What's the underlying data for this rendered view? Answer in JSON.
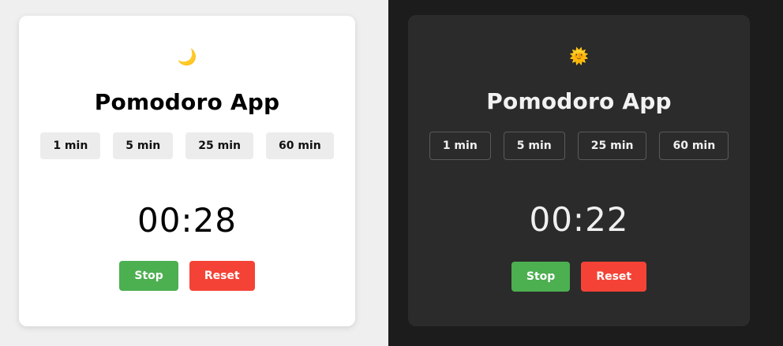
{
  "panels": [
    {
      "theme": "light",
      "theme_icon": "🌙",
      "theme_icon_name": "moon-icon",
      "title": "Pomodoro App",
      "durations": [
        "1 min",
        "5 min",
        "25 min",
        "60 min"
      ],
      "timer": "00:28",
      "stop_label": "Stop",
      "reset_label": "Reset"
    },
    {
      "theme": "dark",
      "theme_icon": "🌞",
      "theme_icon_name": "sun-icon",
      "title": "Pomodoro App",
      "durations": [
        "1 min",
        "5 min",
        "25 min",
        "60 min"
      ],
      "timer": "00:22",
      "stop_label": "Stop",
      "reset_label": "Reset"
    }
  ],
  "colors": {
    "stop": "#4caf50",
    "reset": "#f44336",
    "light_bg": "#efefef",
    "dark_bg": "#1c1c1c",
    "dark_card": "#2b2b2b"
  }
}
